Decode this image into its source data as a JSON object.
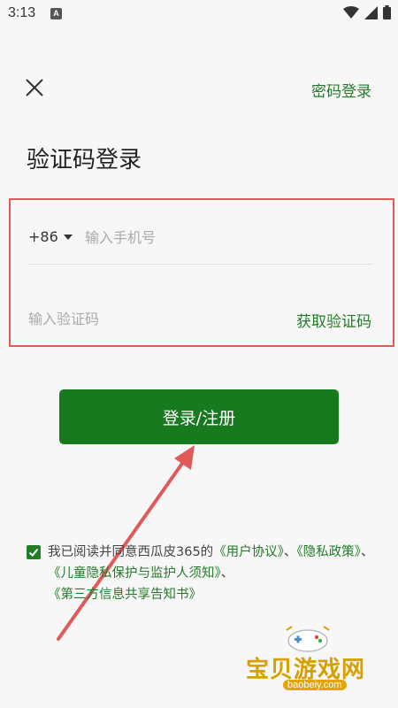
{
  "status_bar": {
    "time": "3:13",
    "a_badge": "A"
  },
  "header": {
    "alt_login": "密码登录"
  },
  "page": {
    "title": "验证码登录"
  },
  "form": {
    "country_code": "+86",
    "phone_placeholder": "输入手机号",
    "code_placeholder": "输入验证码",
    "get_code": "获取验证码"
  },
  "submit": {
    "label": "登录/注册"
  },
  "agreement": {
    "prefix": "我已阅读并同意西瓜皮365的",
    "link1": "《用户协议》",
    "sep1": "、",
    "link2": "《隐私政策》",
    "sep2": "、",
    "link3": "《儿童隐私保护与监护人须知》",
    "sep3": "、",
    "link4": "《第三方信息共享告知书》",
    "checked": true
  },
  "watermark": {
    "name": "宝贝游戏网",
    "url": "baobeiy.com"
  },
  "colors": {
    "accent": "#177a1f",
    "annotation": "#e05a5a"
  }
}
